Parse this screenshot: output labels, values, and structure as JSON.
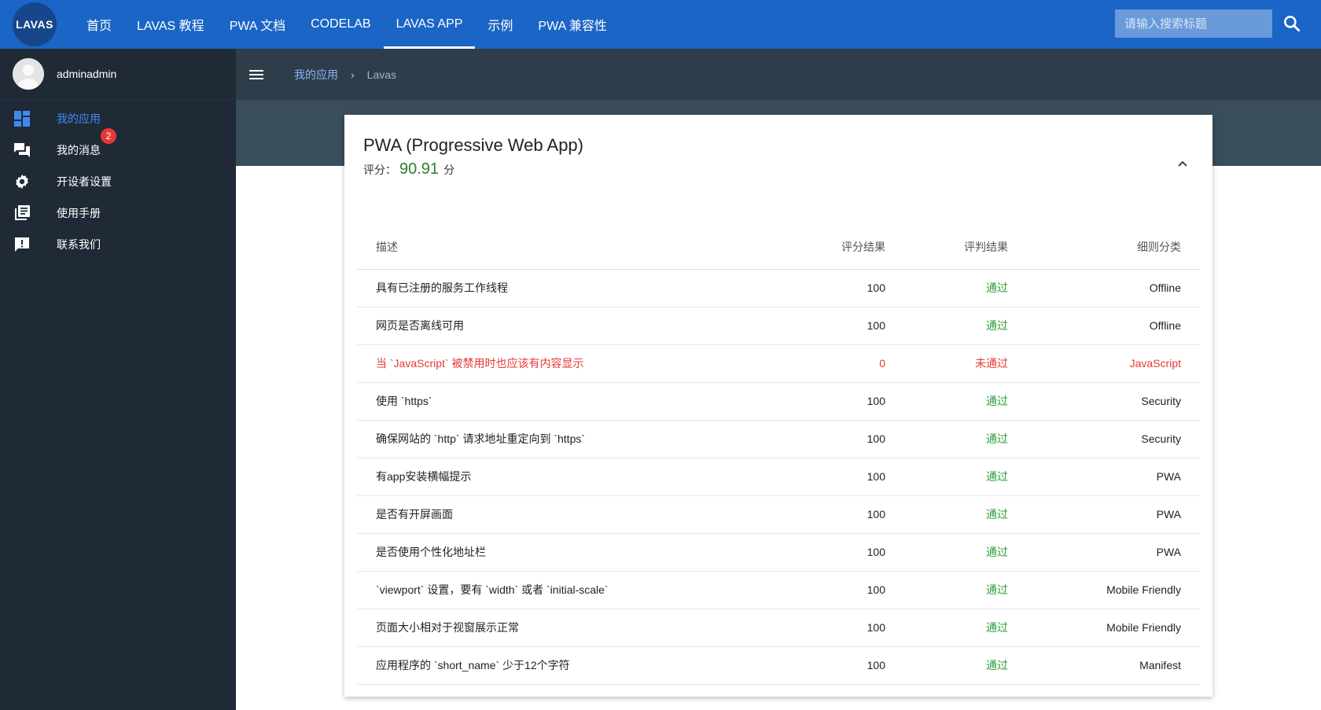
{
  "topbar": {
    "logo": "LAVAS",
    "nav": [
      {
        "label": "首页",
        "active": false
      },
      {
        "label": "LAVAS 教程",
        "active": false
      },
      {
        "label": "PWA 文档",
        "active": false
      },
      {
        "label": "CODELAB",
        "active": false
      },
      {
        "label": "LAVAS APP",
        "active": true
      },
      {
        "label": "示例",
        "active": false
      },
      {
        "label": "PWA 兼容性",
        "active": false
      }
    ],
    "search_placeholder": "请输入搜索标题",
    "search_icon": "search-icon"
  },
  "sidebar": {
    "username": "adminadmin",
    "items": [
      {
        "label": "我的应用",
        "icon": "dashboard-icon",
        "active": true
      },
      {
        "label": "我的消息",
        "icon": "chat-icon",
        "badge": "2"
      },
      {
        "label": "开设者设置",
        "icon": "gear-icon"
      },
      {
        "label": "使用手册",
        "icon": "library-books-icon"
      },
      {
        "label": "联系我们",
        "icon": "feedback-icon"
      }
    ]
  },
  "breadcrumb": {
    "root": "我的应用",
    "separator": "›",
    "current": "Lavas"
  },
  "card": {
    "title": "PWA (Progressive Web App)",
    "score_prefix": "评分：",
    "score": "90.91",
    "score_unit": "分",
    "headers": {
      "desc": "描述",
      "score": "评分结果",
      "judge": "评判结果",
      "category": "细则分类"
    },
    "rows": [
      {
        "desc": "具有已注册的服务工作线程",
        "score": "100",
        "judge": "通过",
        "category": "Offline",
        "pass": true
      },
      {
        "desc": "网页是否离线可用",
        "score": "100",
        "judge": "通过",
        "category": "Offline",
        "pass": true
      },
      {
        "desc": "当 `JavaScript` 被禁用时也应该有内容显示",
        "score": "0",
        "judge": "未通过",
        "category": "JavaScript",
        "pass": false
      },
      {
        "desc": "使用 `https`",
        "score": "100",
        "judge": "通过",
        "category": "Security",
        "pass": true
      },
      {
        "desc": "确保网站的 `http` 请求地址重定向到 `https`",
        "score": "100",
        "judge": "通过",
        "category": "Security",
        "pass": true
      },
      {
        "desc": "有app安装横幅提示",
        "score": "100",
        "judge": "通过",
        "category": "PWA",
        "pass": true
      },
      {
        "desc": "是否有开屏画面",
        "score": "100",
        "judge": "通过",
        "category": "PWA",
        "pass": true
      },
      {
        "desc": "是否使用个性化地址栏",
        "score": "100",
        "judge": "通过",
        "category": "PWA",
        "pass": true
      },
      {
        "desc": "`viewport` 设置，要有 `width` 或者 `initial-scale`",
        "score": "100",
        "judge": "通过",
        "category": "Mobile Friendly",
        "pass": true
      },
      {
        "desc": "页面大小相对于视窗展示正常",
        "score": "100",
        "judge": "通过",
        "category": "Mobile Friendly",
        "pass": true
      },
      {
        "desc": "应用程序的 `short_name` 少于12个字符",
        "score": "100",
        "judge": "通过",
        "category": "Manifest",
        "pass": true
      }
    ]
  },
  "colors": {
    "topbar": "#1a65c5",
    "sidebar": "#1f2a36",
    "subheader": "#2d3d4a",
    "pass": "#2e9d3a",
    "fail": "#e53935",
    "active_link": "#3d8bf2"
  }
}
